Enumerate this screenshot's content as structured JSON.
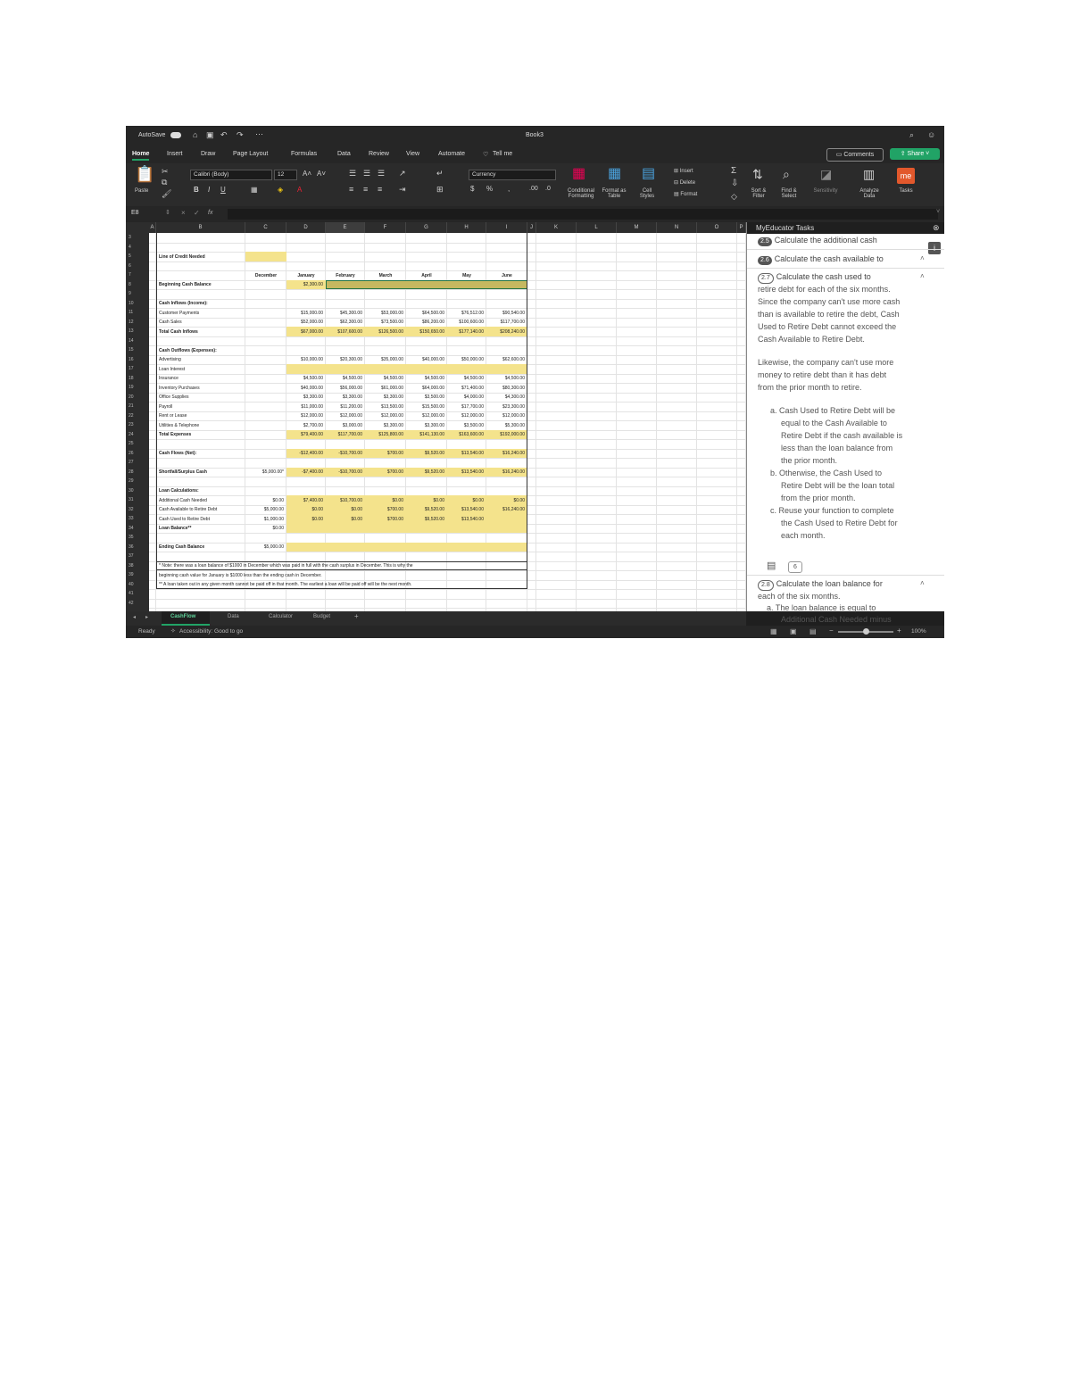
{
  "title_bar": {
    "autosave": "AutoSave",
    "title": "Book3"
  },
  "menu": {
    "items": [
      "Home",
      "Insert",
      "Draw",
      "Page Layout",
      "Formulas",
      "Data",
      "Review",
      "View",
      "Automate",
      "Tell me"
    ],
    "comments": "Comments",
    "share": "Share"
  },
  "ribbon": {
    "paste": "Paste",
    "font_name": "Calibri (Body)",
    "font_size": "12",
    "number_format": "Currency",
    "conditional": "Conditional Formatting",
    "format_table": "Format as Table",
    "cell_styles": "Cell Styles",
    "insert": "Insert",
    "delete": "Delete",
    "format": "Format",
    "sort": "Sort & Filter",
    "find": "Find & Select",
    "sensitivity": "Sensitivity",
    "analyze": "Analyze Data",
    "tasks": "Tasks"
  },
  "formula_bar": {
    "cell_ref": "E8",
    "fx": "fx"
  },
  "columns": [
    "A",
    "B",
    "C",
    "D",
    "E",
    "F",
    "G",
    "H",
    "I",
    "J",
    "K",
    "L",
    "M",
    "N",
    "O",
    "P"
  ],
  "rows": [
    "3",
    "4",
    "5",
    "6",
    "7",
    "8",
    "9",
    "10",
    "11",
    "12",
    "13",
    "14",
    "15",
    "16",
    "17",
    "18",
    "19",
    "20",
    "21",
    "22",
    "23",
    "24",
    "25",
    "26",
    "27",
    "28",
    "29",
    "30",
    "31",
    "32",
    "33",
    "34",
    "35",
    "36",
    "37",
    "38",
    "39",
    "40",
    "41",
    "42"
  ],
  "sheet": {
    "line_of_credit": "Line of Credit Needed",
    "headers": [
      "December",
      "January",
      "February",
      "March",
      "April",
      "May",
      "June"
    ],
    "beginning_cash": "Beginning Cash Balance",
    "beginning_jan": "$2,300.00",
    "cash_inflows": "Cash Inflows (Income):",
    "customer_payments": "Customer Payments",
    "cash_sales": "Cash Sales",
    "total_inflows": "Total Cash Inflows",
    "customer_vals": [
      "$15,000.00",
      "$45,300.00",
      "$53,000.00",
      "$64,500.00",
      "$76,512.00",
      "$90,540.00"
    ],
    "cash_sales_vals": [
      "$52,000.00",
      "$62,300.00",
      "$73,500.00",
      "$86,200.00",
      "$100,600.00",
      "$117,700.00"
    ],
    "total_inflow_vals": [
      "$67,000.00",
      "$107,600.00",
      "$126,500.00",
      "$150,650.00",
      "$177,140.00",
      "$208,240.00"
    ],
    "cash_outflows": "Cash Outflows (Expenses):",
    "expense_labels": [
      "Advertising",
      "Loan Interest",
      "Insurance",
      "Inventory Purchases",
      "Office Supplies",
      "Payroll",
      "Rent or Lease",
      "Utilities & Telephone"
    ],
    "total_expenses": "Total Expenses",
    "advertising_vals": [
      "$10,000.00",
      "$20,300.00",
      "$35,000.00",
      "$40,000.00",
      "$50,000.00",
      "$62,600.00"
    ],
    "insurance_vals": [
      "$4,500.00",
      "$4,500.00",
      "$4,500.00",
      "$4,500.00",
      "$4,500.00",
      "$4,500.00"
    ],
    "inventory_vals": [
      "$40,000.00",
      "$56,000.00",
      "$61,000.00",
      "$64,000.00",
      "$71,400.00",
      "$80,300.00"
    ],
    "office_vals": [
      "$3,300.00",
      "$3,300.00",
      "$3,300.00",
      "$3,500.00",
      "$4,000.00",
      "$4,300.00"
    ],
    "payroll_vals": [
      "$11,000.00",
      "$11,200.00",
      "$13,500.00",
      "$15,500.00",
      "$17,700.00",
      "$23,300.00"
    ],
    "rent_vals": [
      "$12,000.00",
      "$12,000.00",
      "$12,000.00",
      "$12,000.00",
      "$12,000.00",
      "$12,000.00"
    ],
    "utilities_vals": [
      "$2,700.00",
      "$3,000.00",
      "$3,300.00",
      "$3,300.00",
      "$3,500.00",
      "$5,300.00"
    ],
    "total_expense_vals": [
      "$79,400.00",
      "$117,700.00",
      "$125,800.00",
      "$141,130.00",
      "$163,600.00",
      "$192,000.00"
    ],
    "cash_flows_net": "Cash Flows (Net):",
    "net_vals": [
      "-$12,400.00",
      "-$10,700.00",
      "$700.00",
      "$9,520.00",
      "$13,540.00",
      "$16,240.00"
    ],
    "shortfall": "Shortfall/Surplus Cash",
    "shortfall_dec": "$5,000.00*",
    "shortfall_vals": [
      "-$7,400.00",
      "-$10,700.00",
      "$700.00",
      "$9,520.00",
      "$13,540.00",
      "$16,240.00"
    ],
    "loan_calcs": "Loan Calculations:",
    "additional_cash": "Additional Cash Needed",
    "cash_available": "Cash Available to Retire Debt",
    "cash_used": "Cash Used to Retire Debt",
    "loan_balance": "Loan Balance**",
    "add_dec": "$0.00",
    "add_vals": [
      "$7,400.00",
      "$10,700.00",
      "$0.00",
      "$0.00",
      "$0.00",
      "$0.00"
    ],
    "avail_dec": "$5,000.00",
    "avail_vals": [
      "$0.00",
      "$0.00",
      "$700.00",
      "$9,520.00",
      "$13,540.00",
      "$16,240.00"
    ],
    "used_dec": "$1,000.00",
    "used_vals": [
      "$0.00",
      "$0.00",
      "$700.00",
      "$9,520.00",
      "$13,540.00"
    ],
    "loan_dec": "$0.00",
    "ending_cash": "Ending Cash Balance",
    "ending_dec": "$5,000.00",
    "note1": "* Note: there was a loan balance of $1000 in December which was paid in full with the cash surplus in December. This is why the",
    "note2": "beginning cash value for January is $1000 less than the ending cash in December.",
    "note3": "** A loan taken out in any given month cannot be paid off in that month. The earliest a loan will be paid off will be the next month."
  },
  "pane": {
    "title": "MyEducator Tasks",
    "t1_num": "2.5",
    "t1": "Calculate the additional cash",
    "t2_num": "2.6",
    "t2": "Calculate the cash available to",
    "t3_num": "2.7",
    "t3": "Calculate the cash used to",
    "lines": [
      "retire debt for each of the six months.",
      "Since the company can't use more cash",
      "than is available to retire the debt, Cash",
      "Used to Retire Debt cannot exceed the",
      "Cash Available to Retire Debt."
    ],
    "lines2": [
      "Likewise, the company can't use more",
      "money to retire debt than it has debt",
      "from the prior month to retire."
    ],
    "list": [
      "a.  Cash Used to Retire Debt will be",
      "equal to the Cash Available to",
      "Retire Debt if the cash available is",
      "less than the loan balance from",
      "the prior month.",
      "b.  Otherwise, the Cash Used to",
      "Retire Debt will be the loan total",
      "from the prior month.",
      "c.  Reuse your function to complete",
      "the Cash Used to Retire Debt for",
      "each month."
    ],
    "badge": "6",
    "t4_num": "2.8",
    "t4": "Calculate the loan balance for",
    "t4b": "each of the six months.",
    "t4c": "a.  The loan balance is equal to",
    "t4d": "Additional Cash Needed minus"
  },
  "tabs": [
    "CashFlow",
    "Data",
    "Calculator",
    "Budget",
    "+"
  ],
  "status": {
    "ready": "Ready",
    "accessibility": "Accessibility: Good to go",
    "zoom": "100%"
  }
}
